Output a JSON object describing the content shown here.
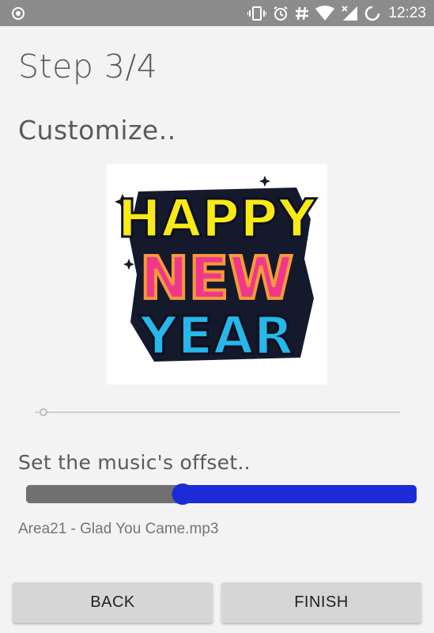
{
  "status_bar": {
    "time": "12:23",
    "icons": [
      "record-icon",
      "vibrate-icon",
      "alarm-icon",
      "hash-icon",
      "wifi-icon",
      "signal-icon",
      "sync-icon"
    ]
  },
  "wizard": {
    "step_title": "Step 3/4",
    "section_title": "Customize.."
  },
  "image": {
    "description_icon": "happy-new-year-image",
    "line1": "HAPPY",
    "line2": "NEW",
    "line3": "YEAR"
  },
  "slider": {
    "value": 0.02
  },
  "music": {
    "offset_label": "Set the music's offset..",
    "offset_value": 0.4,
    "file_name": "Area21 - Glad You Came.mp3"
  },
  "buttons": {
    "back_label": "BACK",
    "finish_label": "FINISH"
  },
  "colors": {
    "accent": "#1c2bd6",
    "status_bar": "#8c8c8c",
    "background": "#f3f3f3"
  }
}
